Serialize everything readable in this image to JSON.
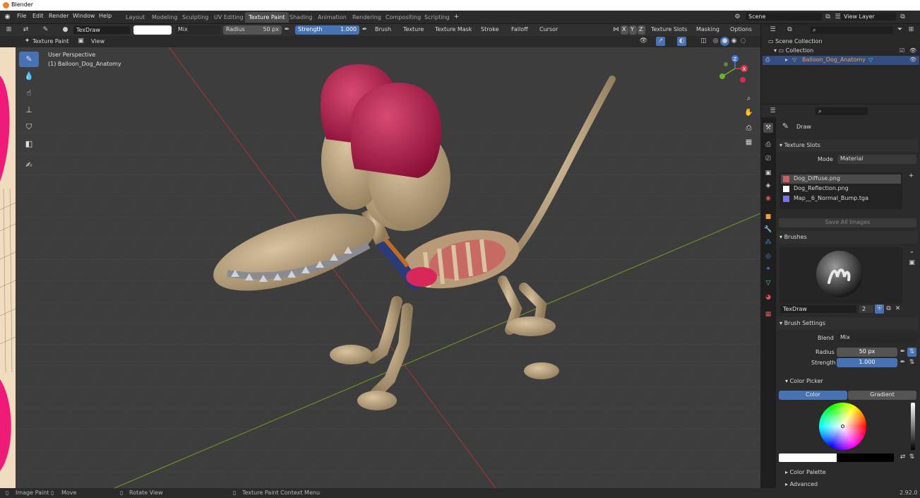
{
  "app": {
    "title": "Blender",
    "version": "2.92.0"
  },
  "menu": [
    "File",
    "Edit",
    "Render",
    "Window",
    "Help"
  ],
  "workspaces": [
    {
      "label": "Layout",
      "active": false
    },
    {
      "label": "Modeling",
      "active": false
    },
    {
      "label": "Sculpting",
      "active": false
    },
    {
      "label": "UV Editing",
      "active": false
    },
    {
      "label": "Texture Paint",
      "active": true
    },
    {
      "label": "Shading",
      "active": false
    },
    {
      "label": "Animation",
      "active": false
    },
    {
      "label": "Rendering",
      "active": false
    },
    {
      "label": "Compositing",
      "active": false
    },
    {
      "label": "Scripting",
      "active": false
    }
  ],
  "scene": {
    "label": "Scene",
    "view_layer": "View Layer"
  },
  "tool_header": {
    "brush_name": "TexDraw",
    "blend": "Mix",
    "radius_label": "Radius",
    "radius_value": "50 px",
    "strength_label": "Strength",
    "strength_value": "1.000",
    "menus": [
      "Brush",
      "Texture",
      "Texture Mask",
      "Stroke",
      "Falloff",
      "Cursor"
    ],
    "axes": [
      "X",
      "Y",
      "Z"
    ],
    "texture_slots": "Texture Slots",
    "masking": "Masking",
    "options": "Options"
  },
  "view_header": {
    "mode": "Texture Paint",
    "view": "View"
  },
  "viewport": {
    "perspective": "User Perspective",
    "object": "(1) Balloon_Dog_Anatomy",
    "gizmo": {
      "x": "X",
      "y": "Y",
      "z": "Z"
    }
  },
  "outliner": {
    "scene_collection": "Scene Collection",
    "collection": "Collection",
    "object": "Balloon_Dog_Anatomy"
  },
  "properties": {
    "tool_name": "Draw",
    "texture_slots": {
      "title": "Texture Slots",
      "mode_label": "Mode",
      "mode_value": "Material",
      "slots": [
        {
          "name": "Dog_Diffuse.png",
          "selected": true,
          "color": "#c86060"
        },
        {
          "name": "Dog_Reflection.png",
          "selected": false,
          "color": "#ffffff"
        },
        {
          "name": "Map__6_Normal_Bump.tga",
          "selected": false,
          "color": "#7a74e0"
        }
      ],
      "save_all": "Save All Images"
    },
    "brushes": {
      "title": "Brushes",
      "name": "TexDraw",
      "users": "2"
    },
    "brush_settings": {
      "title": "Brush Settings",
      "blend_label": "Blend",
      "blend_value": "Mix",
      "radius_label": "Radius",
      "radius_value": "50 px",
      "strength_label": "Strength",
      "strength_value": "1.000",
      "color_picker": "Color Picker",
      "tabs": [
        "Color",
        "Gradient"
      ],
      "color_palette": "Color Palette",
      "advanced": "Advanced"
    }
  },
  "statusbar": {
    "image_paint": "Image Paint",
    "move": "Move",
    "rotate_view": "Rotate View",
    "context_menu": "Texture Paint Context Menu",
    "version": "2.92.0"
  },
  "colors": {
    "accent": "#4772b3",
    "balloon_red": "#b0204a",
    "bone": "#c9b08a",
    "grid_red": "#9a3535",
    "grid_green": "#6b8f2a"
  }
}
